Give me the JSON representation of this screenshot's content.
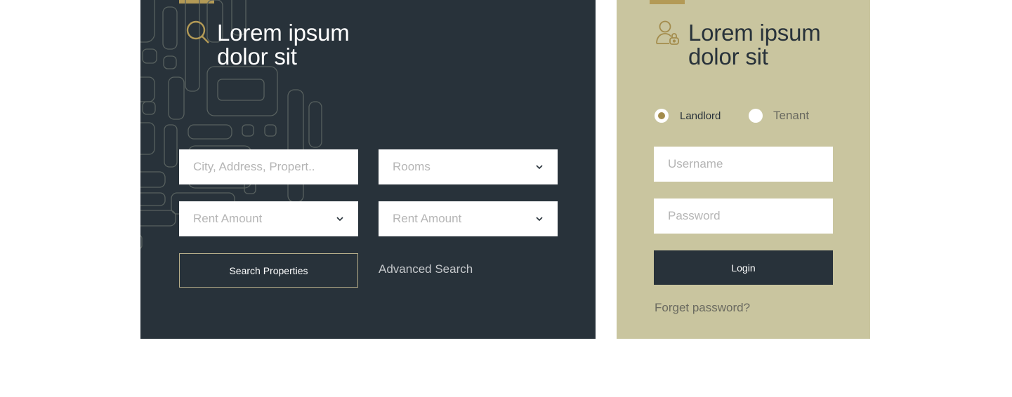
{
  "search_panel": {
    "title_line1": "Lorem ipsum",
    "title_line2": "dolor sit",
    "fields": {
      "location_placeholder": "City, Address, Propert..",
      "rooms_placeholder": "Rooms",
      "rent_amount_1": "Rent Amount",
      "rent_amount_2": "Rent Amount"
    },
    "search_button": "Search Properties",
    "advanced_link": "Advanced Search"
  },
  "login_panel": {
    "title_line1": "Lorem ipsum",
    "title_line2": "dolor sit",
    "radio_options": [
      {
        "label": "Landlord",
        "checked": true
      },
      {
        "label": "Tenant",
        "checked": false
      }
    ],
    "username_placeholder": "Username",
    "password_placeholder": "Password",
    "login_button": "Login",
    "forgot_link": "Forget password?"
  },
  "colors": {
    "dark": "#28323a",
    "gold": "#b39a56",
    "beige": "#c9c59f"
  },
  "icons": {
    "search": "search-icon",
    "user": "user-lock-icon",
    "chevron": "chevron-down-icon"
  }
}
